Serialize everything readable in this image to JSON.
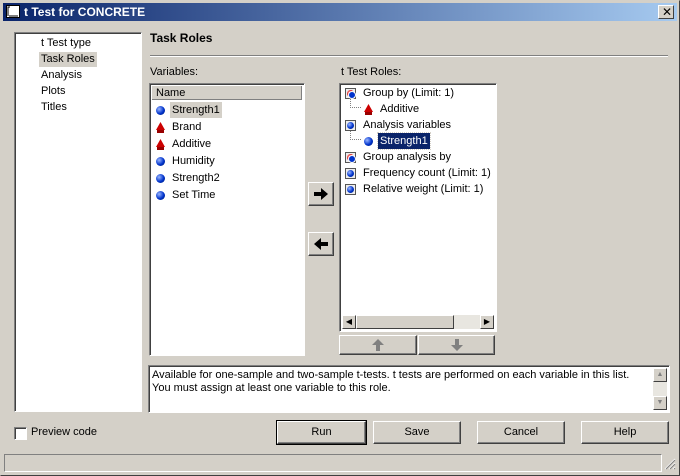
{
  "window": {
    "title": "t Test for CONCRETE"
  },
  "nav": {
    "items": [
      {
        "label": "t Test type",
        "selected": false
      },
      {
        "label": "Task Roles",
        "selected": true
      },
      {
        "label": "Analysis",
        "selected": false
      },
      {
        "label": "Plots",
        "selected": false
      },
      {
        "label": "Titles",
        "selected": false
      }
    ]
  },
  "section": {
    "title": "Task Roles"
  },
  "variables": {
    "label": "Variables:",
    "column_header": "Name",
    "items": [
      {
        "label": "Strength1",
        "icon": "numeric-variable-icon"
      },
      {
        "label": "Brand",
        "icon": "character-variable-icon"
      },
      {
        "label": "Additive",
        "icon": "character-variable-icon"
      },
      {
        "label": "Humidity",
        "icon": "numeric-variable-icon"
      },
      {
        "label": "Strength2",
        "icon": "numeric-variable-icon"
      },
      {
        "label": "Set Time",
        "icon": "numeric-variable-icon"
      }
    ]
  },
  "arrows": {
    "add": "➔",
    "remove": "🡐"
  },
  "roles": {
    "label": "t Test Roles:",
    "items": [
      {
        "label": "Group by  (Limit: 1)"
      },
      {
        "label": "Additive",
        "child": true
      },
      {
        "label": "Analysis variables"
      },
      {
        "label": "Strength1",
        "child": true
      },
      {
        "label": "Group analysis by"
      },
      {
        "label": "Frequency count  (Limit: 1)"
      },
      {
        "label": "Relative weight  (Limit: 1)"
      }
    ],
    "move_up": "🡑",
    "move_down": "🡓"
  },
  "description": "Available for one-sample and two-sample t-tests. t tests are performed on each variable in this list. You must assign at least one variable to this role.",
  "preview_code": {
    "label": "Preview code",
    "checked": false
  },
  "buttons": {
    "run": "Run",
    "save": "Save",
    "cancel": "Cancel",
    "help": "Help"
  },
  "colors": {
    "title_start": "#0a246a",
    "title_end": "#a6caf0",
    "selection": "#0a246a",
    "face": "#d4d0c8"
  }
}
